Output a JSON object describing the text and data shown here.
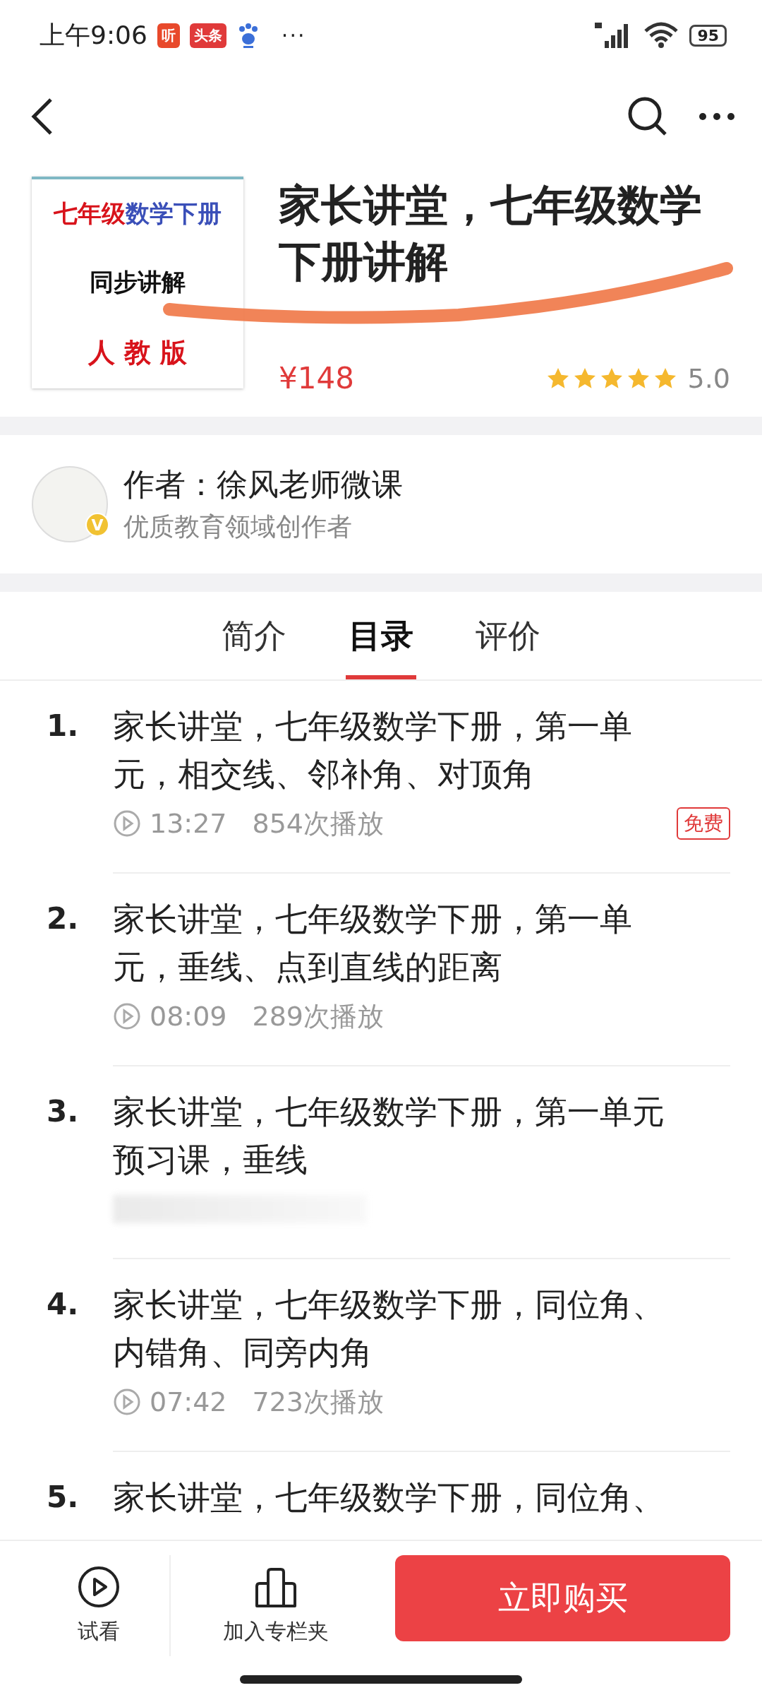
{
  "status_bar": {
    "time": "上午9:06",
    "app_badges": [
      {
        "label": "听",
        "kind": "filled",
        "color": "#e8492b"
      },
      {
        "label": "头条",
        "kind": "filled",
        "color": "#e03a3a"
      }
    ],
    "more": "···",
    "battery": "95"
  },
  "course": {
    "cover": {
      "line_1": "七年级",
      "line_1b": "数学下册",
      "line_2": "同步讲解",
      "line_3": "人 教 版"
    },
    "title": "家长讲堂，七年级数学下册讲解",
    "price": "¥148",
    "stars": 5,
    "rating": "5.0"
  },
  "author": {
    "name": "作者：徐风老师微课",
    "badge": "V",
    "description": "优质教育领域创作者"
  },
  "tabs": [
    {
      "label": "简介",
      "selected": false
    },
    {
      "label": "目录",
      "selected": true
    },
    {
      "label": "评价",
      "selected": false
    }
  ],
  "lessons": [
    {
      "number": "1.",
      "title": "家长讲堂，七年级数学下册，第一单元，相交线、邻补角、对顶角",
      "duration": "13:27",
      "plays": "854次播放",
      "free": true,
      "loading": false
    },
    {
      "number": "2.",
      "title": "家长讲堂，七年级数学下册，第一单元，垂线、点到直线的距离",
      "duration": "08:09",
      "plays": "289次播放",
      "free": false,
      "loading": false
    },
    {
      "number": "3.",
      "title": "家长讲堂，七年级数学下册，第一单元预习课，垂线",
      "free": false,
      "loading": true
    },
    {
      "number": "4.",
      "title": "家长讲堂，七年级数学下册，同位角、内错角、同旁内角",
      "duration": "07:42",
      "plays": "723次播放",
      "free": false,
      "loading": false
    },
    {
      "number": "5.",
      "title": "家长讲堂，七年级数学下册，同位角、",
      "free": false,
      "loading": false
    }
  ],
  "free_label": "免费",
  "bottom_bar": {
    "trial": "试看",
    "collect": "加入专栏夹",
    "buy": "立即购买"
  }
}
